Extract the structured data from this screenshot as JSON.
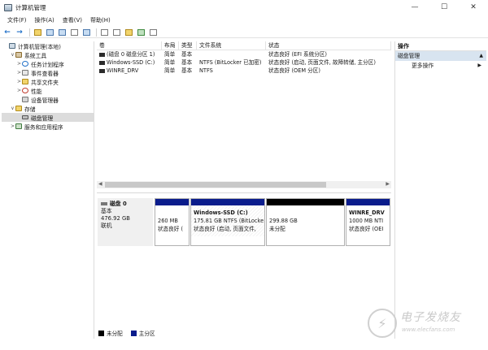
{
  "window": {
    "title": "计算机管理",
    "minimize": "—",
    "maximize": "☐",
    "close": "✕"
  },
  "menu": [
    "文件(F)",
    "操作(A)",
    "查看(V)",
    "帮助(H)"
  ],
  "tree": [
    {
      "label": "计算机管理(本地)",
      "depth": 0,
      "twisty": "",
      "icon": "computer-icon",
      "selected": false
    },
    {
      "label": "系统工具",
      "depth": 1,
      "twisty": "∨",
      "icon": "tools-icon",
      "selected": false
    },
    {
      "label": "任务计划程序",
      "depth": 2,
      "twisty": ">",
      "icon": "clock-icon",
      "selected": false
    },
    {
      "label": "事件查看器",
      "depth": 2,
      "twisty": ">",
      "icon": "event-viewer-icon",
      "selected": false
    },
    {
      "label": "共享文件夹",
      "depth": 2,
      "twisty": ">",
      "icon": "folder-icon",
      "selected": false
    },
    {
      "label": "性能",
      "depth": 2,
      "twisty": ">",
      "icon": "performance-icon",
      "selected": false
    },
    {
      "label": "设备管理器",
      "depth": 2,
      "twisty": "",
      "icon": "device-manager-icon",
      "selected": false
    },
    {
      "label": "存储",
      "depth": 1,
      "twisty": "∨",
      "icon": "storage-icon",
      "selected": false
    },
    {
      "label": "磁盘管理",
      "depth": 2,
      "twisty": "",
      "icon": "disk-icon",
      "selected": true
    },
    {
      "label": "服务和应用程序",
      "depth": 1,
      "twisty": ">",
      "icon": "services-icon",
      "selected": false
    }
  ],
  "volume_list": {
    "headers": [
      "卷",
      "布局",
      "类型",
      "文件系统",
      "状态"
    ],
    "rows": [
      [
        "(磁盘 0 磁盘分区 1)",
        "简单",
        "基本",
        "",
        "状态良好 (EFI 系统分区)"
      ],
      [
        "Windows-SSD (C:)",
        "简单",
        "基本",
        "NTFS (BitLocker 已加密)",
        "状态良好 (启动, 页面文件, 故障转储, 主分区)"
      ],
      [
        "WINRE_DRV",
        "简单",
        "基本",
        "NTFS",
        "状态良好 (OEM 分区)"
      ]
    ]
  },
  "disk": {
    "name": "磁盘 0",
    "type": "基本",
    "size": "476.92 GB",
    "status": "联机",
    "partitions": [
      {
        "name": "",
        "size": "260 MB",
        "detail": "状态良好 (",
        "bar": "primary"
      },
      {
        "name": "Windows-SSD  (C:)",
        "size": "175.81 GB NTFS (BitLocke",
        "detail": "状态良好 (启动, 页面文件,",
        "bar": "primary"
      },
      {
        "name": "",
        "size": "299.88 GB",
        "detail": "未分配",
        "bar": "unallocated"
      },
      {
        "name": "WINRE_DRV",
        "size": "1000 MB NTI",
        "detail": "状态良好 (OEI",
        "bar": "primary"
      }
    ]
  },
  "legend": [
    {
      "label": "未分配",
      "color": "#000000"
    },
    {
      "label": "主分区",
      "color": "#0a1c8c"
    }
  ],
  "actions": {
    "title": "操作",
    "section": "磁盘管理",
    "items": [
      "更多操作"
    ]
  },
  "watermark": {
    "cn": "电子发烧友",
    "en": "www.elecfans.com"
  }
}
